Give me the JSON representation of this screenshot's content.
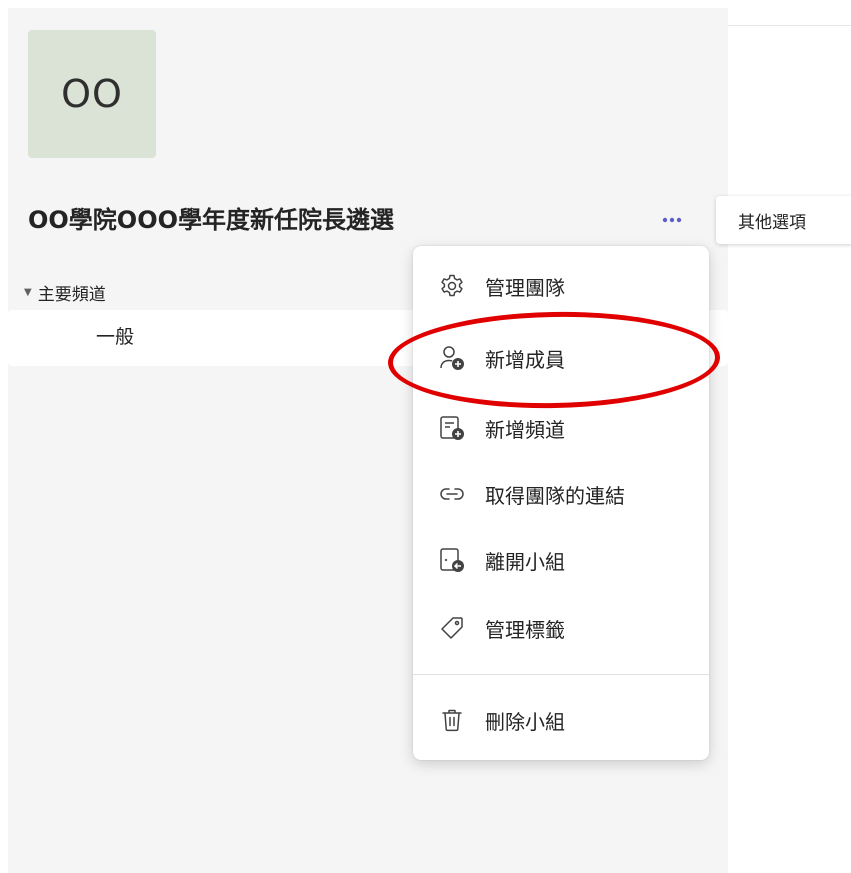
{
  "team": {
    "avatar_text": "OO",
    "name": "OO學院OOO學年度新任院長遴選"
  },
  "more_options_tooltip": "其他選項",
  "channels": {
    "section_label": "主要頻道",
    "items": [
      {
        "label": "一般"
      }
    ]
  },
  "menu": {
    "items": [
      {
        "label": "管理團隊",
        "icon": "gear-icon"
      },
      {
        "label": "新增成員",
        "icon": "add-person-icon"
      },
      {
        "label": "新增頻道",
        "icon": "add-channel-icon"
      },
      {
        "label": "取得團隊的連結",
        "icon": "link-icon"
      },
      {
        "label": "離開小組",
        "icon": "leave-icon"
      },
      {
        "label": "管理標籤",
        "icon": "tag-icon"
      },
      {
        "label": "刪除小組",
        "icon": "trash-icon"
      }
    ]
  },
  "colors": {
    "accent": "#5b5fc7",
    "annotation": "#e00000",
    "avatar_bg": "#dbe2d6"
  }
}
